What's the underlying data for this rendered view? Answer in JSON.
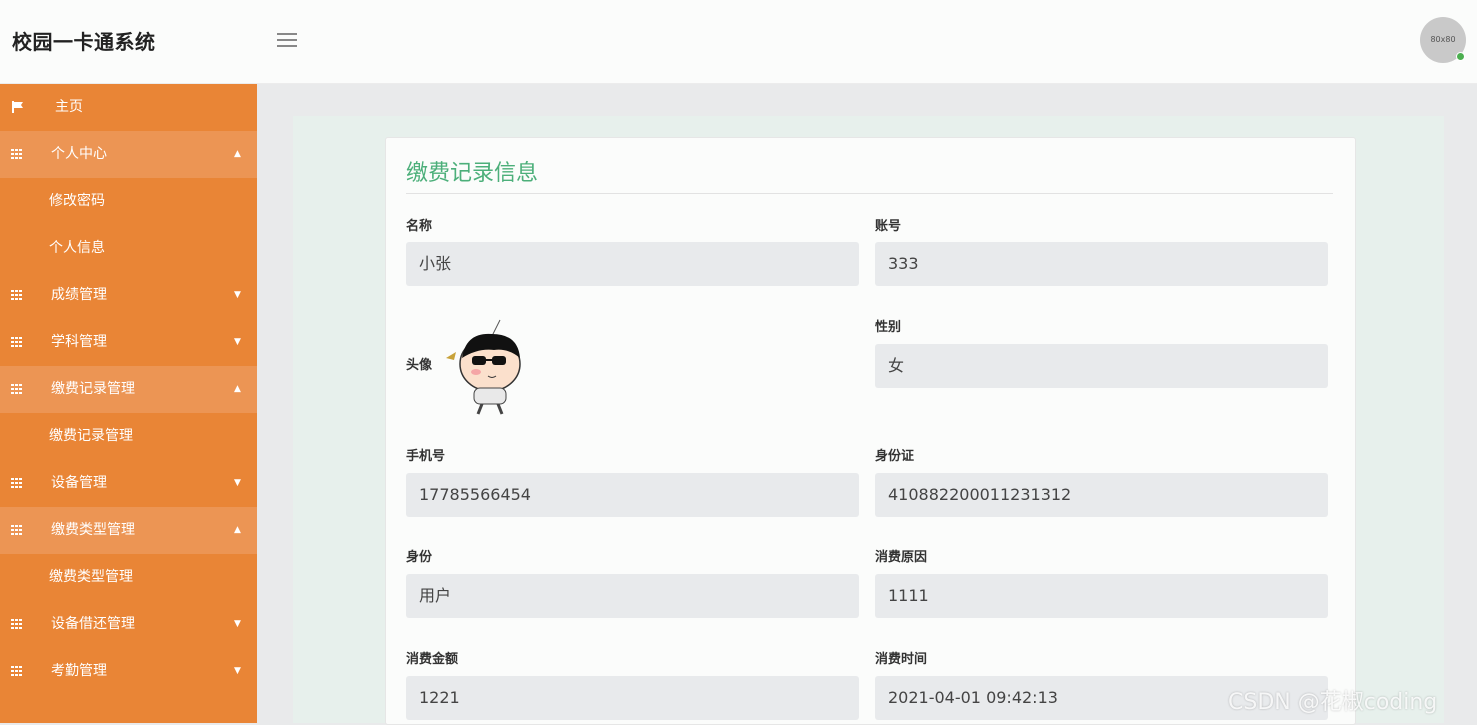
{
  "app": {
    "title": "校园一卡通系统",
    "avatar_text": "80x80"
  },
  "sidebar": {
    "home": "主页",
    "groups": [
      {
        "label": "个人中心",
        "caret": "▲",
        "children": [
          "修改密码",
          "个人信息"
        ]
      },
      {
        "label": "成绩管理",
        "caret": "▼",
        "children": []
      },
      {
        "label": "学科管理",
        "caret": "▼",
        "children": []
      },
      {
        "label": "缴费记录管理",
        "caret": "▲",
        "children": [
          "缴费记录管理"
        ]
      },
      {
        "label": "设备管理",
        "caret": "▼",
        "children": []
      },
      {
        "label": "缴费类型管理",
        "caret": "▲",
        "children": [
          "缴费类型管理"
        ]
      },
      {
        "label": "设备借还管理",
        "caret": "▼",
        "children": []
      },
      {
        "label": "考勤管理",
        "caret": "▼",
        "children": []
      }
    ]
  },
  "form": {
    "title": "缴费记录信息",
    "name": {
      "label": "名称",
      "value": "小张"
    },
    "account": {
      "label": "账号",
      "value": "333"
    },
    "avatar": {
      "label": "头像"
    },
    "gender": {
      "label": "性别",
      "value": "女"
    },
    "phone": {
      "label": "手机号",
      "value": "17785566454"
    },
    "idcard": {
      "label": "身份证",
      "value": "410882200011231312"
    },
    "identity": {
      "label": "身份",
      "value": "用户"
    },
    "reason": {
      "label": "消费原因",
      "value": "1111"
    },
    "amount": {
      "label": "消费金额",
      "value": "1221"
    },
    "time": {
      "label": "消费时间",
      "value": "2021-04-01 09:42:13"
    }
  },
  "watermark": "CSDN @花椒coding",
  "colors": {
    "sidebar": "#e98536",
    "accent_green": "#4caf7a"
  }
}
